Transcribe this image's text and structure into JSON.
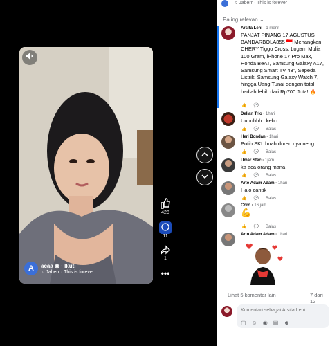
{
  "video": {
    "username": "acaa",
    "follow_label": "Ikuti",
    "music": "Jaberr · This is forever"
  },
  "actions": {
    "like_count": "428",
    "comment_count": "11",
    "share_count": "1"
  },
  "panel": {
    "top_music": "Jaberr · This is forever",
    "sort_label": "Paling relevan"
  },
  "comments": [
    {
      "name": "Arsita Leni",
      "time": "1 menit",
      "text": "PANJAT PINANG 17 AGUSTUS BANDARBOLA855 🇮🇩 Menangkan CHERY Tiggo Cross, Logam Mulia 100 Gram, iPhone 17 Pro Max, Honda BeAT, Samsung Galaxy A17, Samsung Smart TV 43\", Sepeda Listrik, Samsung Galaxy Watch 7, hingga Uang Tunai dengan total hadiah lebih dari Rp700 Juta! 🔥",
      "reply": ""
    },
    {
      "name": "Delian Trio",
      "time": "1hari",
      "text": "Uuuuhhh.. kebo",
      "reply": "Balas"
    },
    {
      "name": "Heri Bondan",
      "time": "1hari",
      "text": "Putih SKL buah duren nya neng",
      "reply": "Balas"
    },
    {
      "name": "Umar Stec",
      "time": "1jam",
      "text": "ka aca orang mana",
      "reply": "Balas"
    },
    {
      "name": "Arto Adam Adam",
      "time": "1hari",
      "text": "Halo cantik",
      "reply": "Balas"
    },
    {
      "name": "Coro",
      "time": "16 jam",
      "text": "💪",
      "reply": "Balas"
    },
    {
      "name": "Arto Adam Adam",
      "time": "1hari",
      "text": "",
      "reply": ""
    }
  ],
  "footer": {
    "more_label": "Lihat 5 komentar lain",
    "page": "7 dari 12",
    "input_placeholder": "Komentari sebagai Arsita Leni"
  }
}
